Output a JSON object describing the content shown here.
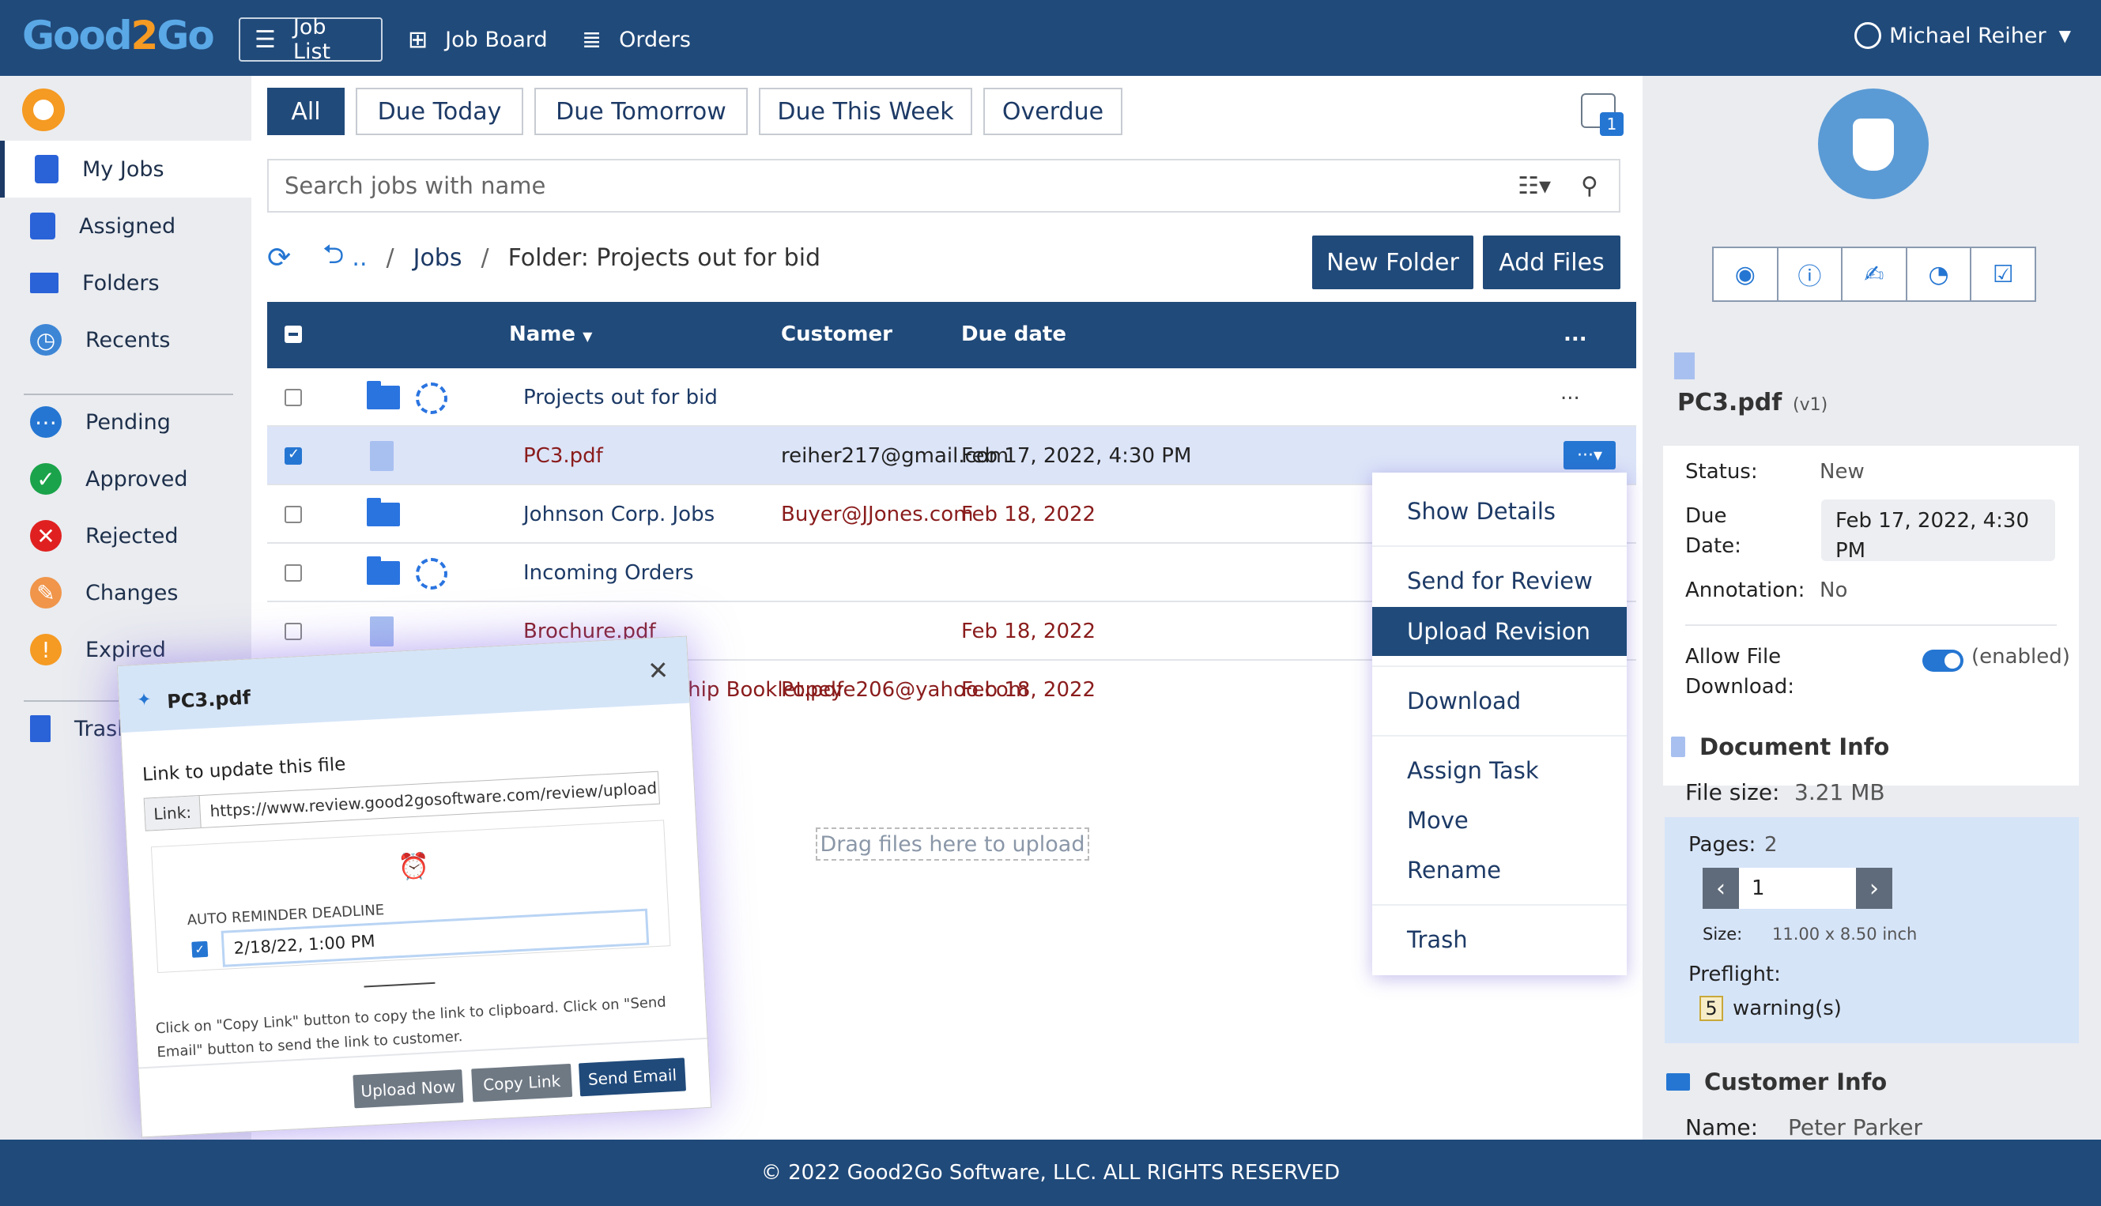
{
  "header": {
    "logo": {
      "part1": "Good",
      "part2": "2",
      "part3": "Go"
    },
    "nav": [
      {
        "label": "Job List"
      },
      {
        "label": "Job Board"
      },
      {
        "label": "Orders"
      }
    ],
    "user": "Michael Reiher"
  },
  "sidebar": {
    "items": [
      {
        "label": "My Jobs"
      },
      {
        "label": "Assigned"
      },
      {
        "label": "Folders"
      },
      {
        "label": "Recents"
      },
      {
        "label": "Pending"
      },
      {
        "label": "Approved"
      },
      {
        "label": "Rejected"
      },
      {
        "label": "Changes"
      },
      {
        "label": "Expired"
      },
      {
        "label": "Trash"
      }
    ]
  },
  "filters": [
    "All",
    "Due Today",
    "Due Tomorrow",
    "Due This Week",
    "Overdue"
  ],
  "notify_count": "1",
  "search": {
    "placeholder": "Search jobs with name"
  },
  "breadcrumb": {
    "up": "..",
    "sep": "/",
    "root": "Jobs",
    "current": "Folder: Projects out for bid"
  },
  "buttons": {
    "new_folder": "New Folder",
    "add_files": "Add Files"
  },
  "table": {
    "headers": {
      "name": "Name",
      "customer": "Customer",
      "due": "Due date",
      "more": "..."
    },
    "rows": [
      {
        "name": "Projects out for bid",
        "customer": "",
        "due": "",
        "more": "..."
      },
      {
        "name": "PC3.pdf",
        "customer": "reiher217@gmail.com",
        "due": "Feb 17, 2022, 4:30 PM",
        "more": "···▾"
      },
      {
        "name": "Johnson Corp. Jobs",
        "customer": "Buyer@JJones.com",
        "due": "Feb 18, 2022"
      },
      {
        "name": "Incoming Orders",
        "customer": "",
        "due": ""
      },
      {
        "name": "Brochure.pdf",
        "customer": "",
        "due": "Feb 18, 2022"
      },
      {
        "name": "orhip Booklet.pdf",
        "customer": "Popeye206@yahoo.com",
        "due": "Feb 18, 2022"
      }
    ]
  },
  "dropzone": "Drag files here to upload",
  "menu": [
    "Show Details",
    "Send for Review",
    "Upload Revision",
    "Download",
    "Assign Task",
    "Move",
    "Rename",
    "Trash"
  ],
  "details": {
    "file_name": "PC3.pdf",
    "version": "(v1)",
    "status_label": "Status:",
    "status": "New",
    "due_label_1": "Due",
    "due_label_2": "Date:",
    "due_value_1": "Feb 17, 2022, 4:30",
    "due_value_2": "PM",
    "annotation_label": "Annotation:",
    "annotation": "No",
    "allow_label_1": "Allow File",
    "allow_label_2": "Download:",
    "allow_state": "(enabled)",
    "doc_info_title": "Document Info",
    "file_size_label": "File size:",
    "file_size": "3.21 MB",
    "pages_label": "Pages:",
    "pages": "2",
    "page_current": "1",
    "size_label": "Size:",
    "size": "11.00 x 8.50 inch",
    "preflight_label": "Preflight:",
    "warnings": "5",
    "warnings_text": "warning(s)",
    "customer_info_title": "Customer Info",
    "customer_name_label": "Name:",
    "customer_name": "Peter Parker"
  },
  "dialog": {
    "title": "PC3.pdf",
    "subtitle": "Link to update this file",
    "link_label": "Link:",
    "link": "https://www.review.good2gosoftware.com/review/upload",
    "reminder_label": "AUTO REMINDER DEADLINE",
    "reminder_value": "2/18/22, 1:00 PM",
    "help": "Click on \"Copy Link\" button to copy the link to clipboard. Click on \"Send Email\" button to send the link to customer.",
    "upload_now": "Upload Now",
    "copy_link": "Copy Link",
    "send_email": "Send Email"
  },
  "footer": "© 2022 Good2Go Software, LLC. ALL RIGHTS RESERVED",
  "colors": {
    "primary": "#204a7a",
    "accent": "#2576d2",
    "orange": "#f59a22",
    "green": "#1aa34a",
    "red": "#e02020"
  }
}
